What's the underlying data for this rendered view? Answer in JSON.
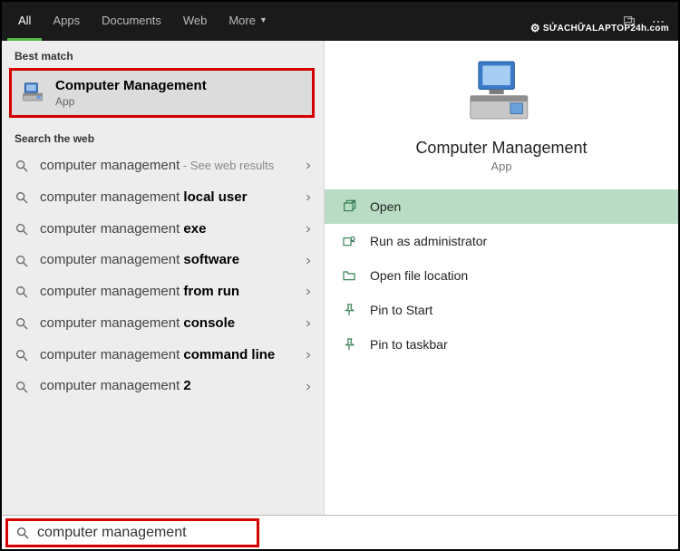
{
  "topbar": {
    "tabs": [
      {
        "label": "All",
        "active": true
      },
      {
        "label": "Apps",
        "active": false
      },
      {
        "label": "Documents",
        "active": false
      },
      {
        "label": "Web",
        "active": false
      },
      {
        "label": "More",
        "active": false
      }
    ]
  },
  "watermark": "SỬACHỮALAPTOP24h.com",
  "sections": {
    "best_label": "Best match",
    "web_label": "Search the web"
  },
  "best": {
    "title": "Computer Management",
    "subtitle": "App"
  },
  "web": [
    {
      "base": "computer management",
      "extra": "",
      "suffix": " - See web results"
    },
    {
      "base": "computer management ",
      "extra": "local user",
      "suffix": ""
    },
    {
      "base": "computer management ",
      "extra": "exe",
      "suffix": ""
    },
    {
      "base": "computer management ",
      "extra": "software",
      "suffix": ""
    },
    {
      "base": "computer management ",
      "extra": "from run",
      "suffix": ""
    },
    {
      "base": "computer management ",
      "extra": "console",
      "suffix": ""
    },
    {
      "base": "computer management ",
      "extra": "command line",
      "suffix": ""
    },
    {
      "base": "computer management ",
      "extra": "2",
      "suffix": ""
    }
  ],
  "preview": {
    "title": "Computer Management",
    "subtitle": "App",
    "actions": [
      {
        "label": "Open",
        "icon": "open",
        "selected": true
      },
      {
        "label": "Run as administrator",
        "icon": "admin",
        "selected": false
      },
      {
        "label": "Open file location",
        "icon": "folder",
        "selected": false
      },
      {
        "label": "Pin to Start",
        "icon": "pin",
        "selected": false
      },
      {
        "label": "Pin to taskbar",
        "icon": "pin",
        "selected": false
      }
    ]
  },
  "search": {
    "query": "computer management"
  }
}
